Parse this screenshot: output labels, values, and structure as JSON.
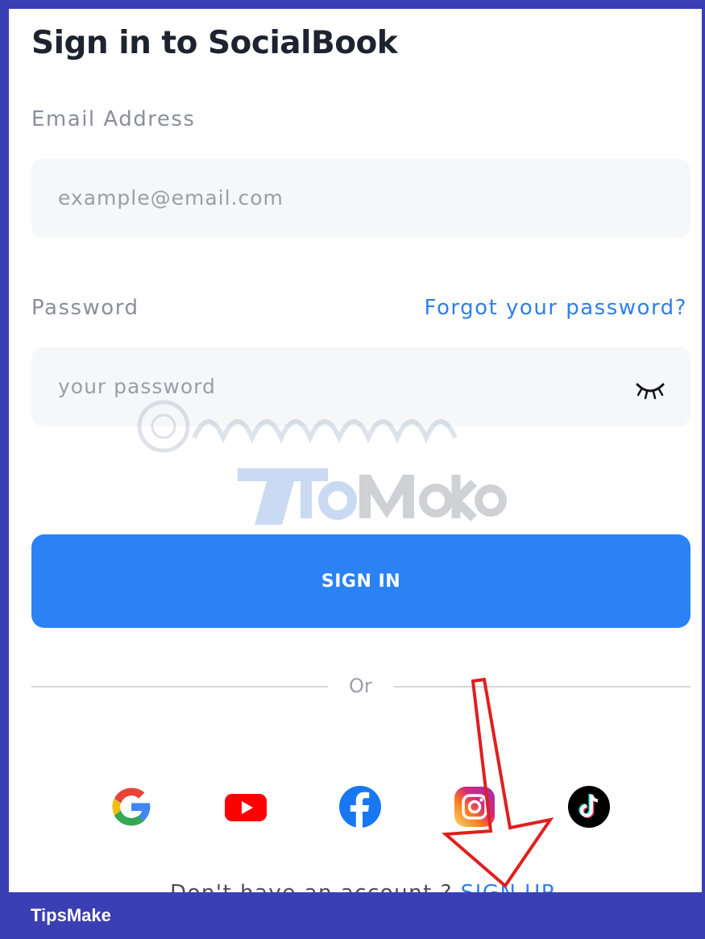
{
  "page": {
    "title": "Sign in to SocialBook",
    "email": {
      "label": "Email Address",
      "placeholder": "example@email.com"
    },
    "password": {
      "label": "Password",
      "placeholder": "your password",
      "forgot_link": "Forgot your password?"
    },
    "signin_button": "SIGN IN",
    "divider_text": "Or",
    "social_icons": [
      "google-icon",
      "youtube-icon",
      "facebook-icon",
      "instagram-icon",
      "tiktok-icon"
    ],
    "signup": {
      "prompt": "Don't have an account ? ",
      "link": "SIGN UP"
    }
  },
  "footer": {
    "brand": "TipsMake"
  },
  "colors": {
    "accent": "#2a82f4",
    "frame_border": "#3a3fb4",
    "link": "#2f7fe8",
    "annotation_arrow": "#e01f1f"
  }
}
